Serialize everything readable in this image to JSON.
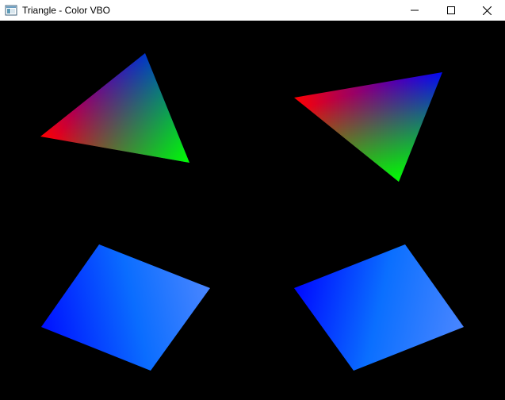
{
  "window": {
    "title": "Triangle - Color VBO",
    "icon": "opengl-window-icon",
    "controls": {
      "minimize_icon": "minimize-icon",
      "maximize_icon": "maximize-icon",
      "close_icon": "close-icon"
    }
  },
  "scene": {
    "background_color": "#000000",
    "shapes": [
      {
        "name": "triangle-top-left",
        "type": "triangle",
        "vertex_colors": [
          "#ff0000",
          "#0000ff",
          "#00ff00"
        ]
      },
      {
        "name": "triangle-top-right",
        "type": "triangle",
        "vertex_colors": [
          "#ff0000",
          "#0000ff",
          "#00ff00"
        ]
      },
      {
        "name": "quad-bottom-left",
        "type": "quad",
        "colors": [
          "#0000ff",
          "#0a6fff",
          "#4a86ff"
        ]
      },
      {
        "name": "quad-bottom-right",
        "type": "quad",
        "colors": [
          "#0000ff",
          "#0a6fff",
          "#4a86ff"
        ]
      }
    ]
  }
}
